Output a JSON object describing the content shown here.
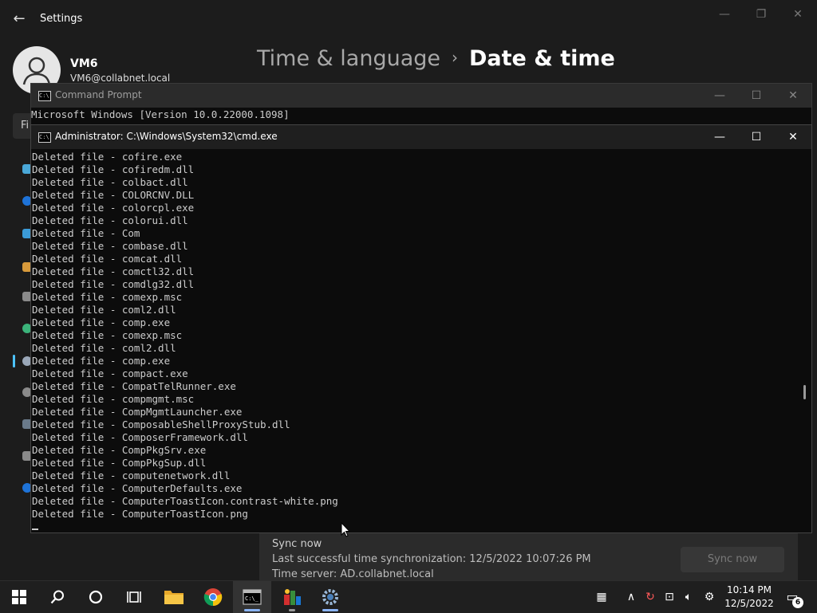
{
  "settings": {
    "title": "Settings",
    "user": {
      "name": "VM6",
      "email": "VM6@collabnet.local"
    },
    "breadcrumb": {
      "parent": "Time & language",
      "separator": "›",
      "current": "Date & time"
    },
    "find_placeholder": "Fi",
    "sync": {
      "title": "Sync now",
      "last_sync": "Last successful time synchronization: 12/5/2022 10:07:26 PM",
      "time_server": "Time server: AD.collabnet.local",
      "button_label": "Sync now"
    }
  },
  "cmd_background": {
    "title": "Command Prompt",
    "version_line": "Microsoft Windows [Version 10.0.22000.1098]"
  },
  "cmd_front": {
    "title": "Administrator: C:\\Windows\\System32\\cmd.exe",
    "lines": [
      "Deleted file - cofire.exe",
      "Deleted file - cofiredm.dll",
      "Deleted file - colbact.dll",
      "Deleted file - COLORCNV.DLL",
      "Deleted file - colorcpl.exe",
      "Deleted file - colorui.dll",
      "Deleted file - Com",
      "Deleted file - combase.dll",
      "Deleted file - comcat.dll",
      "Deleted file - comctl32.dll",
      "Deleted file - comdlg32.dll",
      "Deleted file - comexp.msc",
      "Deleted file - coml2.dll",
      "Deleted file - comp.exe",
      "Deleted file - comexp.msc",
      "Deleted file - coml2.dll",
      "Deleted file - comp.exe",
      "Deleted file - compact.exe",
      "Deleted file - CompatTelRunner.exe",
      "Deleted file - compmgmt.msc",
      "Deleted file - CompMgmtLauncher.exe",
      "Deleted file - ComposableShellProxyStub.dll",
      "Deleted file - ComposerFramework.dll",
      "Deleted file - CompPkgSrv.exe",
      "Deleted file - CompPkgSup.dll",
      "Deleted file - computenetwork.dll",
      "Deleted file - ComputerDefaults.exe",
      "Deleted file - ComputerToastIcon.contrast-white.png",
      "Deleted file - ComputerToastIcon.png"
    ]
  },
  "taskbar": {
    "apps": [
      "start-icon",
      "search-icon",
      "cortana-icon",
      "task-view-icon",
      "file-explorer-icon",
      "chrome-icon",
      "cmd-icon",
      "app-icon",
      "settings-icon"
    ],
    "clock": {
      "time": "10:14 PM",
      "date": "12/5/2022"
    },
    "notification_count": "6"
  }
}
